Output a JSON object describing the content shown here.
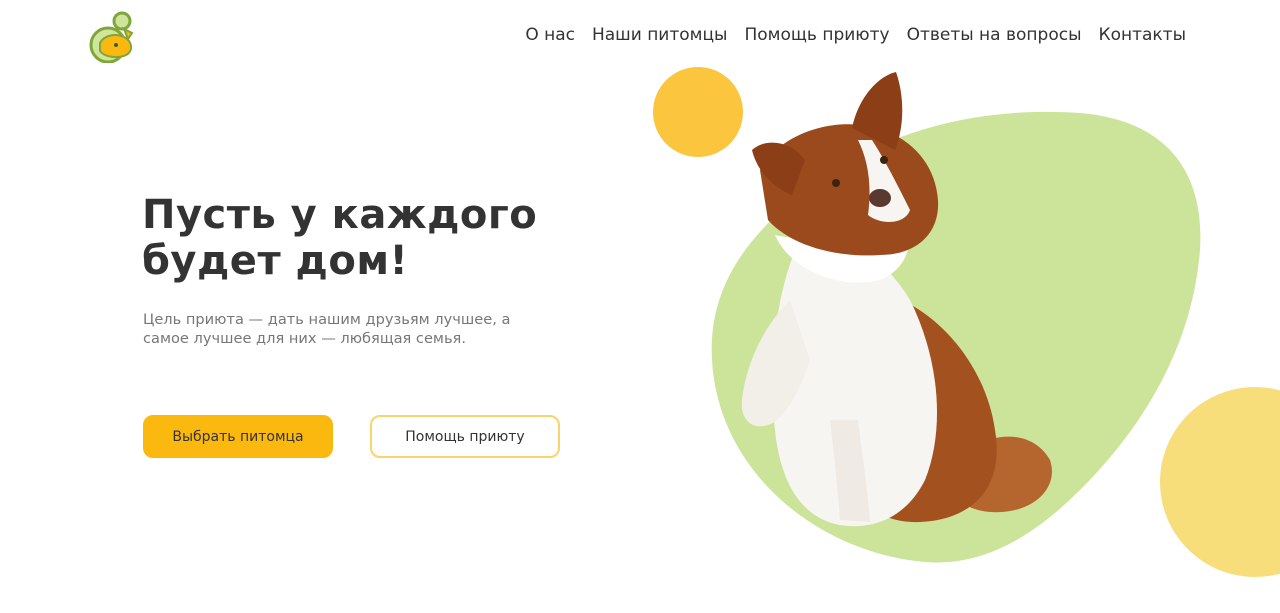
{
  "header": {
    "logo": {
      "icon": "shelter-logo-icon",
      "colors": {
        "ring": "#7fa63a",
        "fill": "#cfe59c",
        "accent": "#fbb80f"
      }
    },
    "nav": [
      {
        "label": "О нас"
      },
      {
        "label": "Наши питомцы"
      },
      {
        "label": "Помощь приюту"
      },
      {
        "label": "Ответы на вопросы"
      },
      {
        "label": "Контакты"
      }
    ]
  },
  "hero": {
    "title_line1": "Пусть у каждого",
    "title_line2": "будет дом!",
    "subtitle_line1": "Цель приюта — дать нашим друзьям лучшее, а",
    "subtitle_line2": "самое лучшее для них — любящая семья.",
    "primary_button": "Выбрать питомца",
    "secondary_button": "Помощь приюту"
  },
  "illustration": {
    "image": "border-collie-dog",
    "colors": {
      "blob": "#cce49a",
      "circle_top": "#fbc53e",
      "circle_right": "#f8dd7b",
      "dog_brown": "#9a4a1c",
      "dog_white": "#f7f5f1"
    }
  },
  "theme": {
    "accent": "#fbb80f",
    "text": "#333333",
    "muted": "#777777"
  }
}
